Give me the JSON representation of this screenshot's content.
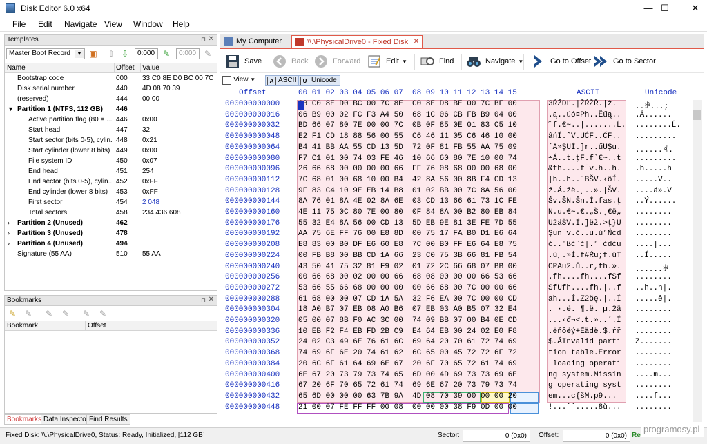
{
  "window": {
    "title": "Disk Editor 6.0 x64",
    "minimize": "—",
    "maximize": "☐",
    "close": "✕"
  },
  "menu": [
    "File",
    "Edit",
    "Navigate",
    "View",
    "Window",
    "Help"
  ],
  "templates": {
    "title": "Templates",
    "selected_template": "Master Boot Record",
    "field1": "0:000",
    "field2": "0:000",
    "columns": [
      "Name",
      "Offset",
      "Value"
    ],
    "rows": [
      {
        "name": "Bootstrap code",
        "offset": "000",
        "value": "33 C0 8E D0 BC 00 7C 8..."
      },
      {
        "name": "Disk serial number",
        "offset": "440",
        "value": "4D 08 70 39"
      },
      {
        "name": "(reserved)",
        "offset": "444",
        "value": "00 00"
      },
      {
        "name": "Partition 1 (NTFS, 112 GB)",
        "offset": "446",
        "value": "",
        "expander": "▼"
      },
      {
        "name": "Active partition flag (80 = ...",
        "offset": "446",
        "value": "0x00"
      },
      {
        "name": "Start head",
        "offset": "447",
        "value": "32"
      },
      {
        "name": "Start sector (bits 0-5), cylin...",
        "offset": "448",
        "value": "0x21"
      },
      {
        "name": "Start cylinder (lower 8 bits)",
        "offset": "449",
        "value": "0x00"
      },
      {
        "name": "File system ID",
        "offset": "450",
        "value": "0x07"
      },
      {
        "name": "End head",
        "offset": "451",
        "value": "254"
      },
      {
        "name": "End sector (bits 0-5), cylin...",
        "offset": "452",
        "value": "0xFF"
      },
      {
        "name": "End cylinder (lower 8 bits)",
        "offset": "453",
        "value": "0xFF"
      },
      {
        "name": "First sector",
        "offset": "454",
        "value": "2 048"
      },
      {
        "name": "Total sectors",
        "offset": "458",
        "value": "234 436 608"
      },
      {
        "name": "Partition 2 (Unused)",
        "offset": "462",
        "value": "",
        "expander": "›"
      },
      {
        "name": "Partition 3 (Unused)",
        "offset": "478",
        "value": "",
        "expander": "›"
      },
      {
        "name": "Partition 4 (Unused)",
        "offset": "494",
        "value": "",
        "expander": "›"
      },
      {
        "name": "Signature (55 AA)",
        "offset": "510",
        "value": "55 AA"
      }
    ]
  },
  "bookmarks": {
    "title": "Bookmarks",
    "columns": [
      "Bookmark",
      "Offset"
    ]
  },
  "bottom_tabs": [
    "Bookmarks",
    "Data Inspector",
    "Find Results"
  ],
  "doc_tabs": [
    "My Computer",
    "\\\\.\\PhysicalDrive0 - Fixed Disk"
  ],
  "toolbar": {
    "save": "Save",
    "back": "Back",
    "forward": "Forward",
    "edit": "Edit",
    "find": "Find",
    "navigate": "Navigate",
    "goto_offset": "Go to Offset",
    "goto_sector": "Go to Sector"
  },
  "viewbar": {
    "view": "View",
    "ascii": "ASCII",
    "unicode": "Unicode"
  },
  "hex": {
    "offset_header": "Offset",
    "byte_header": "00 01 02 03 04 05 06 07  08 09 10 11 12 13 14 15",
    "ascii_header": "ASCII",
    "unicode_header": "Unicode",
    "rows": [
      {
        "off": "000000000000",
        "hex": "33 C0 8E D0 BC 00 7C 8E  C0 8E D8 BE 00 7C BF 00",
        "ascii": "3ŔŽĐĽ.|ŽŔŽŘ.|ż.",
        "uni": "..ꃭ...;"
      },
      {
        "off": "000000000016",
        "hex": "06 B9 00 02 FC F3 A4 50  68 1C 06 CB FB B9 04 00",
        "ascii": ".ą..üó¤Ph..Ëűą..",
        "uni": ".Ä......"
      },
      {
        "off": "000000000032",
        "hex": "BD 66 07 80 7E 00 00 7C  0B 0F 85 0E 01 83 C5 10",
        "ascii": "˝f.€~..|.......Ĺ.",
        "uni": "........Ĺ."
      },
      {
        "off": "000000000048",
        "hex": "E2 F1 CD 18 88 56 00 55  C6 46 11 05 C6 46 10 00",
        "ascii": "âńÍ.ˆV.UĆF..ĆF..",
        "uni": "........."
      },
      {
        "off": "000000000064",
        "hex": "B4 41 BB AA 55 CD 13 5D  72 0F 81 FB 55 AA 75 09",
        "ascii": "´A»ŞUÍ.]r..űUŞu.",
        "uni": "......ꃬ."
      },
      {
        "off": "000000000080",
        "hex": "F7 C1 01 00 74 03 FE 46  10 66 60 80 7E 10 00 74",
        "ascii": "÷Á..t.ţF.f`€~..t",
        "uni": "........."
      },
      {
        "off": "000000000096",
        "hex": "26 66 68 00 00 00 00 66  FF 76 08 68 00 00 68 00",
        "ascii": "&fh....f˙v.h..h.",
        "uni": ".h.....h"
      },
      {
        "off": "000000000112",
        "hex": "7C 68 01 00 68 10 00 B4  42 8A 56 00 8B F4 CD 13",
        "ascii": "|h..h..´BŠV.‹ôÍ.",
        "uni": ".....V.."
      },
      {
        "off": "000000000128",
        "hex": "9F 83 C4 10 9E EB 14 B8  01 02 BB 00 7C 8A 56 00",
        "ascii": "ź.Ä.žë.¸..».|ŠV.",
        "uni": "....ä».V"
      },
      {
        "off": "000000000144",
        "hex": "8A 76 01 8A 4E 02 8A 6E  03 CD 13 66 61 73 1C FE",
        "ascii": "Šv.ŠN.Šn.Í.fas.ţ",
        "uni": "..Ÿ......"
      },
      {
        "off": "000000000160",
        "hex": "4E 11 75 0C 80 7E 00 80  0F 84 8A 00 B2 80 EB 84",
        "ascii": "N.u.€~.€.„Š.˛€ë„",
        "uni": "........"
      },
      {
        "off": "000000000176",
        "hex": "55 32 E4 8A 56 00 CD 13  5D EB 9E 81 3E FE 7D 55",
        "ascii": "U2äŠV.Í.]ëž.>ţ}U",
        "uni": "........"
      },
      {
        "off": "000000000192",
        "hex": "AA 75 6E FF 76 00 E8 8D  00 75 17 FA B0 D1 E6 64",
        "ascii": "Şun˙v.č..u.ú°Ńćd",
        "uni": "........"
      },
      {
        "off": "000000000208",
        "hex": "E8 83 00 B0 DF E6 60 E8  7C 00 B0 FF E6 64 E8 75",
        "ascii": "č..°ßć`č|.°˙ćdču",
        "uni": "....|..."
      },
      {
        "off": "000000000224",
        "hex": "00 FB B8 00 BB CD 1A 66  23 C0 75 3B 66 81 FB 54",
        "ascii": ".ű¸.»Í.f#Ŕu;f.űT",
        "uni": "..Í....."
      },
      {
        "off": "000000000240",
        "hex": "43 50 41 75 32 81 F9 02  01 72 2C 66 68 07 BB 00",
        "ascii": "CPAu2.ů..r,fh.».",
        "uni": "......ꃭ"
      },
      {
        "off": "000000000256",
        "hex": "00 66 68 00 02 00 00 66  68 08 00 00 00 66 53 66",
        "ascii": ".fh....fh....fSf",
        "uni": "........"
      },
      {
        "off": "000000000272",
        "hex": "53 66 55 66 68 00 00 00  00 66 68 00 7C 00 00 66",
        "ascii": "SfUfh....fh.|..f",
        "uni": "..h..h|."
      },
      {
        "off": "000000000288",
        "hex": "61 68 00 00 07 CD 1A 5A  32 F6 EA 00 7C 00 00 CD",
        "ascii": "ah...Í.Z2öę.|..Í",
        "uni": ".....ê|."
      },
      {
        "off": "000000000304",
        "hex": "18 A0 B7 07 EB 08 A0 B6  07 EB 03 A0 B5 07 32 E4",
        "ascii": ". ·.ë. ¶.ë. µ.2ä",
        "uni": "........"
      },
      {
        "off": "000000000320",
        "hex": "05 00 07 8B F0 AC 3C 00  74 09 BB 07 00 B4 0E CD",
        "ascii": "...‹đ¬<.t.»..´.Í",
        "uni": "........"
      },
      {
        "off": "000000000336",
        "hex": "10 EB F2 F4 EB FD 2B C9  E4 64 EB 00 24 02 E0 F8",
        "ascii": ".ëňôëý+Éädë.$.ŕř",
        "uni": "........"
      },
      {
        "off": "000000000352",
        "hex": "24 02 C3 49 6E 76 61 6C  69 64 20 70 61 72 74 69",
        "ascii": "$.ĂInvalid parti",
        "uni": "Z......."
      },
      {
        "off": "000000000368",
        "hex": "74 69 6F 6E 20 74 61 62  6C 65 00 45 72 72 6F 72",
        "ascii": "tion table.Error",
        "uni": "........"
      },
      {
        "off": "000000000384",
        "hex": "20 6C 6F 61 64 69 6E 67  20 6F 70 65 72 61 74 69",
        "ascii": " loading operati",
        "uni": "........"
      },
      {
        "off": "000000000400",
        "hex": "6E 67 20 73 79 73 74 65  6D 00 4D 69 73 73 69 6E",
        "ascii": "ng system.Missin",
        "uni": "....m..."
      },
      {
        "off": "000000000416",
        "hex": "67 20 6F 70 65 72 61 74  69 6E 67 20 73 79 73 74",
        "ascii": "g operating syst",
        "uni": "........"
      },
      {
        "off": "000000000432",
        "hex": "65 6D 00 00 00 63 7B 9A  4D 08 70 39 00 00 00 20",
        "ascii": "em...c{šM.p9...",
        "uni": "....ſ..."
      },
      {
        "off": "000000000448",
        "hex": "21 00 07 FE FF FF 00 08  00 00 00 38 F9 0D 00 00",
        "ascii": "!...˙˙.....8ů...",
        "uni": "........"
      }
    ]
  },
  "status": {
    "left": "Fixed Disk: \\\\.\\PhysicalDrive0, Status: Ready, Initialized, [112 GB]",
    "sector_label": "Sector:",
    "sector_value": "0 (0x0)",
    "offset_label": "Offset:",
    "offset_value": "0 (0x0)",
    "ready": "Rea"
  },
  "watermark": "programosy.pl"
}
